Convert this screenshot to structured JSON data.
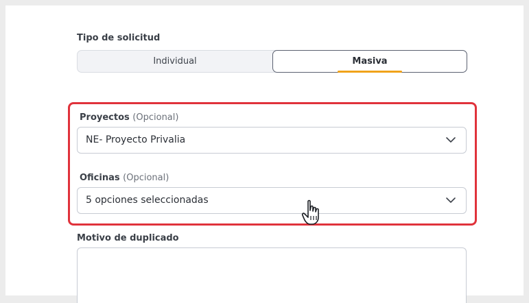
{
  "form": {
    "request_type": {
      "label": "Tipo de solicitud",
      "options": [
        "Individual",
        "Masiva"
      ],
      "selected": "Masiva"
    },
    "proyectos": {
      "label": "Proyectos",
      "optional": "(Opcional)",
      "value": "NE- Proyecto Privalia"
    },
    "oficinas": {
      "label": "Oficinas",
      "optional": "(Opcional)",
      "value": "5 opciones seleccionadas"
    },
    "motivo": {
      "label": "Motivo de duplicado",
      "value": ""
    }
  },
  "colors": {
    "highlight": "#e0323b",
    "accent": "#f0a21a"
  },
  "icons": [
    "chevron-down-icon",
    "hand-pointer-cursor-icon"
  ]
}
